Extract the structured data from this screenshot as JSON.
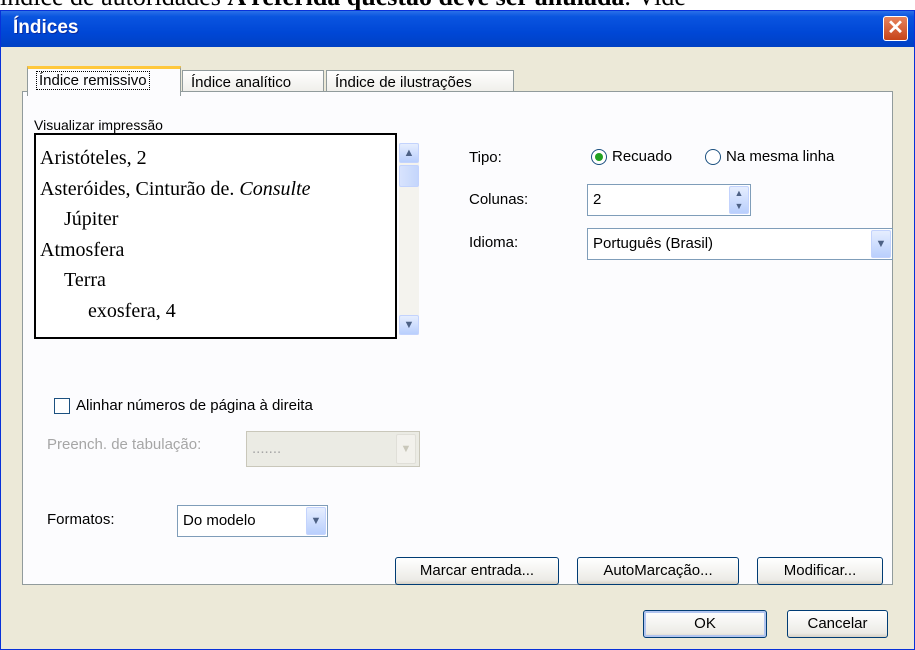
{
  "background_text": {
    "part1": "índice de autoridades",
    "part2": "A referida questão deve ser anulada",
    "part3": ". Vide"
  },
  "window": {
    "title": "Índices"
  },
  "tabs": [
    {
      "label": "Índice remissivo",
      "active": true
    },
    {
      "label": "Índice analítico",
      "active": false
    },
    {
      "label": "Índice de ilustrações",
      "active": false
    }
  ],
  "preview": {
    "label": "Visualizar impressão",
    "lines": [
      {
        "text": "Aristóteles, 2"
      },
      {
        "text": "Asteróides, Cinturão de.",
        "italic": "Consulte"
      },
      {
        "text": "Júpiter"
      },
      {
        "text": "Atmosfera"
      },
      {
        "text": "Terra"
      },
      {
        "text": "exosfera, 4"
      }
    ]
  },
  "tipo": {
    "label": "Tipo:",
    "options": [
      {
        "label": "Recuado",
        "selected": true
      },
      {
        "label": "Na mesma linha",
        "selected": false
      }
    ]
  },
  "colunas": {
    "label": "Colunas:",
    "value": "2"
  },
  "idioma": {
    "label": "Idioma:",
    "value": "Português (Brasil)"
  },
  "alinhar": {
    "label": "Alinhar números de página à direita",
    "checked": false
  },
  "preench": {
    "label": "Preench. de tabulação:",
    "value": "......."
  },
  "formatos": {
    "label": "Formatos:",
    "value": "Do modelo"
  },
  "buttons": {
    "marcar": "Marcar entrada...",
    "automarcacao": "AutoMarcação...",
    "modificar": "Modificar...",
    "ok": "OK",
    "cancelar": "Cancelar"
  },
  "colors": {
    "titlebar": "#0047d6",
    "dialog_bg": "#ece9d8",
    "tab_highlight": "#ffc83c"
  }
}
